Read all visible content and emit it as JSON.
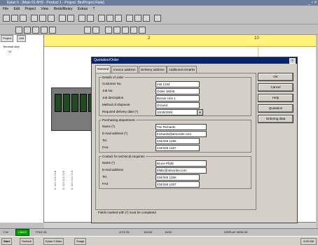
{
  "window": {
    "title": "Eplan 5 - [Main 01 AHS - Product 1 - Project: Bin/Project Rails]",
    "controls": "_ ▫ ×"
  },
  "menu": [
    "File",
    "Edit",
    "Project",
    "View",
    "Redo/library",
    "Extras",
    "?"
  ],
  "left_panel": {
    "tabs": [
      "Project",
      "Unit"
    ],
    "tree_items": [
      "Terminal strip",
      "X1"
    ]
  },
  "ruler": {
    "marks": [
      "2",
      "10"
    ]
  },
  "schematic": {
    "side_labels": [
      "X: 12 / 0.1 / 0.8",
      "X: 12 / 0.1 / 0.9",
      "X: 12 / 0.1 / 1.0"
    ]
  },
  "dialog": {
    "title": "Quotation/Order",
    "tabs": [
      "General",
      "Invoice address",
      "Delivery address",
      "Additional remarks"
    ],
    "groups": {
      "details": {
        "title": "Details of order",
        "fields": [
          {
            "label": "Customer No.",
            "value": "IAB 1234"
          },
          {
            "label": "Job No.",
            "value": "Order 18345"
          },
          {
            "label": "Job description",
            "value": "Burner Unit 1"
          },
          {
            "label": "Method of shipment",
            "value": "Ground"
          },
          {
            "label": "Required delivery date (*)",
            "value": "10/30/2004"
          }
        ]
      },
      "purchasing": {
        "title": "Purchasing department",
        "fields": [
          {
            "label": "Name (*)",
            "value": "Tim Richards"
          },
          {
            "label": "E-mail address (*)",
            "value": "trichards@ahsorder.com"
          },
          {
            "label": "Tel.",
            "value": "434/345 1256"
          },
          {
            "label": "FAX",
            "value": "434/345 1257"
          }
        ]
      },
      "technical": {
        "title": "Contact for technical enquiries",
        "fields": [
          {
            "label": "Name (*)",
            "value": "Bruce Pfaltz"
          },
          {
            "label": "E-mail address",
            "value": "bfaltz@ahsorder.com"
          },
          {
            "label": "Tel.",
            "value": "434/345 1256"
          },
          {
            "label": "FAX",
            "value": "434/345 1257"
          }
        ]
      }
    },
    "footer_note": "Fields marked with (*) must be completed",
    "buttons": [
      "OK",
      "Cancel",
      "Help",
      "Quotation",
      "Ordering data"
    ]
  },
  "status": {
    "left": "7:34",
    "mid": "TTILE 26",
    "green": "LINKS",
    "coords": [
      "X/YZ 25",
      "10/100",
      "13/20"
    ],
    "right": "DISPLAY VIEW 26"
  },
  "taskbar": {
    "start": "Start",
    "items": [
      "Outlook",
      "Eplan 5 Main",
      "Snaglt"
    ],
    "clock": "8:30 AM"
  }
}
